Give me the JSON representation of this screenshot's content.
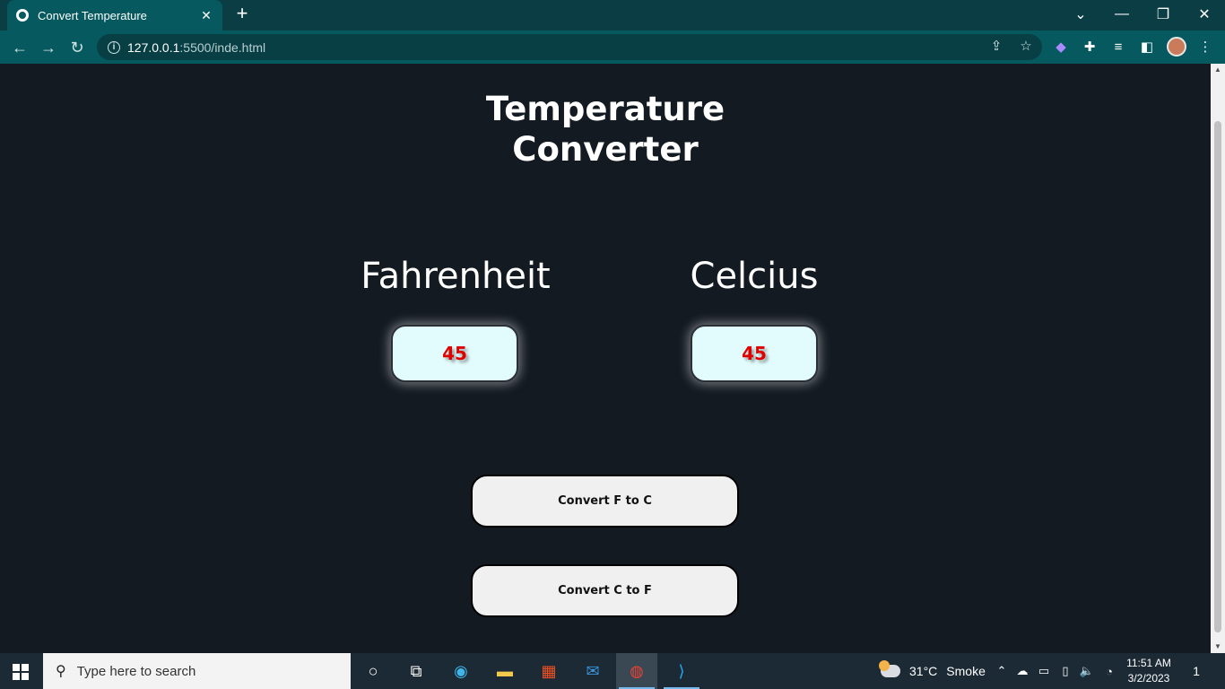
{
  "browser": {
    "tab_title": "Convert Temperature",
    "tab_close": "✕",
    "new_tab": "+",
    "url_host": "127.0.0.1",
    "url_path": ":5500/inde.html",
    "window_controls": {
      "dropdown": "⌄",
      "minimize": "—",
      "restore": "❐",
      "close": "✕"
    }
  },
  "page": {
    "heading_line1": "Temperature",
    "heading_line2": "Converter",
    "fahrenheit_label": "Fahrenheit",
    "celsius_label": "Celcius",
    "fahrenheit_value": "45",
    "celsius_value": "45",
    "convert_f_to_c": "Convert F to C",
    "convert_c_to_f": "Convert C to F"
  },
  "taskbar": {
    "search_placeholder": "Type here to search",
    "weather_temp": "31°C",
    "weather_desc": "Smoke",
    "time": "11:51 AM",
    "date": "3/2/2023",
    "notification_count": "1"
  }
}
